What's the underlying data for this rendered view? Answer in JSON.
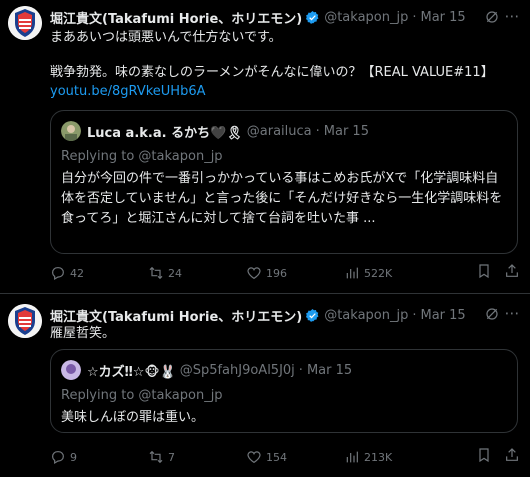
{
  "tweets": [
    {
      "author": {
        "name": "堀江貴文(Takafumi Horie、ホリエモン)",
        "handle": "@takapon_jp",
        "date": "Mar 15"
      },
      "text_line1": "まああいつは頭悪いんで仕方ないです。",
      "text_line2": "戦争勃発。味の素なしのラーメンがそんなに偉いの？【REAL VALUE#11】",
      "link": "youtu.be/8gRVkeUHb6A",
      "quote": {
        "author": {
          "name": "Luca a.k.a. るかち🖤🎗",
          "handle": "@arailuca",
          "date": "Mar 15"
        },
        "replying": "Replying to @takapon_jp",
        "text": "自分が今回の件で一番引っかかっている事はこめお氏がXで「化学調味料自体を否定していません」と言った後に「そんだけ好きなら一生化学調味料を食ってろ」と堀江さんに対して捨て台詞を吐いた事 ..."
      },
      "stats": {
        "replies": "42",
        "retweets": "24",
        "likes": "196",
        "views": "522K"
      }
    },
    {
      "author": {
        "name": "堀江貴文(Takafumi Horie、ホリエモン)",
        "handle": "@takapon_jp",
        "date": "Mar 15"
      },
      "text_line1": "雁屋哲笑。",
      "quote": {
        "author": {
          "name": "☆カズ‼☆🐵🐰",
          "handle": "@Sp5fahJ9oAl5J0j",
          "date": "Mar 15"
        },
        "replying": "Replying to @takapon_jp",
        "text": "美味しんぼの罪は重い。"
      },
      "stats": {
        "replies": "9",
        "retweets": "7",
        "likes": "154",
        "views": "213K"
      }
    }
  ],
  "icons": {
    "reply": "reply-icon",
    "retweet": "retweet-icon",
    "like": "like-icon",
    "views": "views-icon",
    "bookmark": "bookmark-icon",
    "share": "share-icon",
    "more": "more-icon",
    "grok": "grok-icon",
    "verified": "verified-badge-icon"
  },
  "colors": {
    "background": "#000000",
    "text": "#e7e9ea",
    "muted": "#71767b",
    "link": "#1d9bf0",
    "border": "#2f3336"
  }
}
